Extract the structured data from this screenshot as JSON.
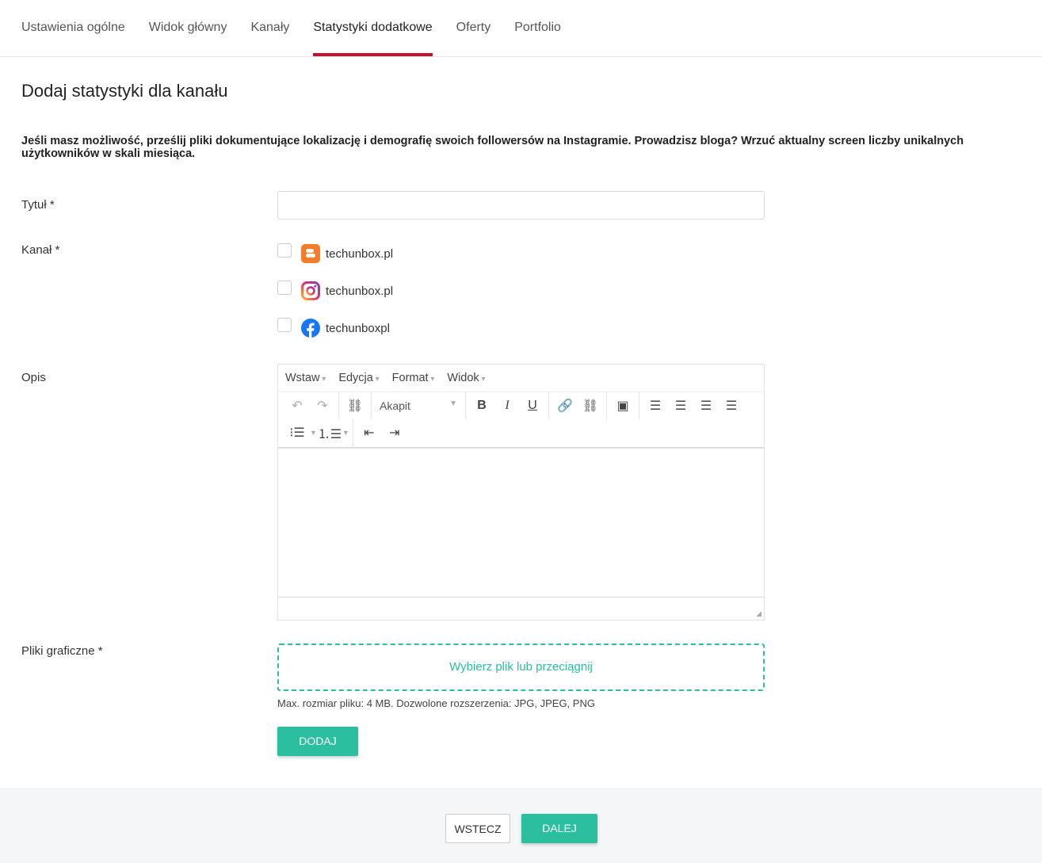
{
  "tabs": [
    "Ustawienia ogólne",
    "Widok główny",
    "Kanały",
    "Statystyki dodatkowe",
    "Oferty",
    "Portfolio"
  ],
  "active_tab": "Statystyki dodatkowe",
  "title": "Dodaj statystyki dla kanału",
  "description": "Jeśli masz możliwość, prześlij pliki dokumentujące lokalizację i demografię swoich followersów na Instagramie. Prowadzisz bloga? Wrzuć aktualny screen liczby unikalnych użytkowników w skali miesiąca.",
  "form": {
    "title_label": "Tytuł *",
    "title_value": "",
    "channel_label": "Kanał *",
    "channels": [
      {
        "icon": "blogger-icon",
        "name": "techunbox.pl",
        "checked": false
      },
      {
        "icon": "instagram-icon",
        "name": "techunbox.pl",
        "checked": false
      },
      {
        "icon": "facebook-icon",
        "name": "techunboxpl",
        "checked": false
      }
    ],
    "desc_label": "Opis",
    "editor": {
      "menus": [
        "Wstaw",
        "Edycja",
        "Format",
        "Widok"
      ],
      "format_select": "Akapit"
    },
    "files_label": "Pliki graficzne  *",
    "drop_text": "Wybierz plik lub przeciągnij",
    "hint": "Max. rozmiar pliku: 4 MB. Dozwolone rozszerzenia: JPG, JPEG, PNG",
    "add_button": "DODAJ"
  },
  "footer": {
    "back": "WSTECZ",
    "next": "DALEJ"
  },
  "colors": {
    "accent": "#2bbf9f",
    "active_tab": "#c8102e"
  }
}
